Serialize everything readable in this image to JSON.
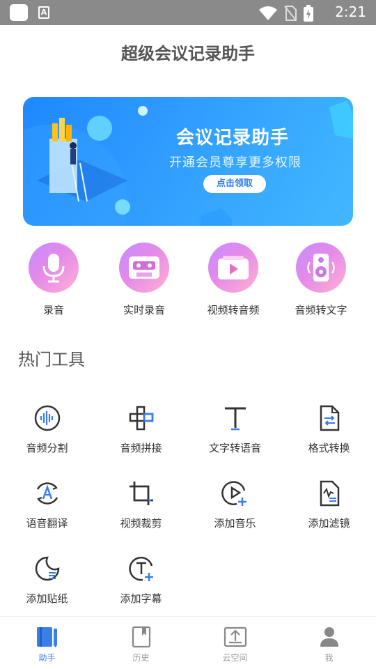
{
  "status_bar": {
    "time": "2:21"
  },
  "app": {
    "title": "超级会议记录助手"
  },
  "banner": {
    "title": "会议记录助手",
    "subtitle": "开通会员尊享更多权限",
    "button": "点击领取"
  },
  "quick_actions": [
    {
      "label": "录音",
      "icon": "microphone-icon"
    },
    {
      "label": "实时录音",
      "icon": "cassette-icon"
    },
    {
      "label": "视频转音频",
      "icon": "video-play-icon"
    },
    {
      "label": "音频转文字",
      "icon": "speaker-icon"
    }
  ],
  "section": {
    "title": "热门工具"
  },
  "tools": [
    {
      "label": "音频分割",
      "icon": "waveform-icon"
    },
    {
      "label": "音频拼接",
      "icon": "splice-icon"
    },
    {
      "label": "文字转语音",
      "icon": "text-t-icon"
    },
    {
      "label": "格式转换",
      "icon": "file-convert-icon"
    },
    {
      "label": "语音翻译",
      "icon": "translate-icon"
    },
    {
      "label": "视频裁剪",
      "icon": "crop-icon"
    },
    {
      "label": "添加音乐",
      "icon": "play-add-icon"
    },
    {
      "label": "添加滤镜",
      "icon": "filter-file-icon"
    },
    {
      "label": "添加贴纸",
      "icon": "sticker-icon"
    },
    {
      "label": "添加字幕",
      "icon": "subtitle-add-icon"
    }
  ],
  "nav": [
    {
      "label": "助手",
      "icon": "assistant-book-icon",
      "active": true
    },
    {
      "label": "历史",
      "icon": "history-bookmark-icon",
      "active": false
    },
    {
      "label": "云空间",
      "icon": "cloud-upload-icon",
      "active": false
    },
    {
      "label": "我",
      "icon": "profile-icon",
      "active": false
    }
  ],
  "colors": {
    "accent": "#3a7ee8",
    "banner_blue": "#2f9bff",
    "quick_gradient": "#d98cf0",
    "status_bar": "#8a8a8a"
  }
}
